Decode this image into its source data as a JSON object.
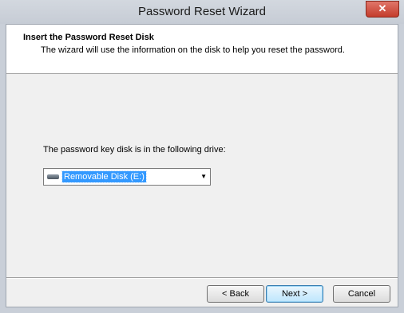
{
  "window": {
    "title": "Password Reset Wizard",
    "close_glyph": "✕"
  },
  "header": {
    "title": "Insert the Password Reset Disk",
    "subtitle": "The wizard will use the information on the disk to help you reset the password."
  },
  "body": {
    "prompt": "The password key disk is in the following drive:",
    "drive_select": {
      "selected": "Removable Disk (E:)",
      "icon": "removable-drive-icon"
    }
  },
  "buttons": {
    "back": "< Back",
    "next": "Next >",
    "cancel": "Cancel"
  }
}
